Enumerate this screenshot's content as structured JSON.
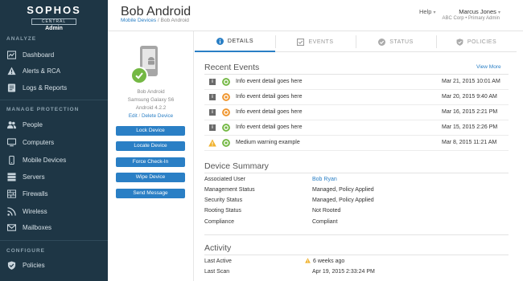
{
  "sidebar": {
    "logo": {
      "word": "SOPHOS",
      "central": "CENTRAL",
      "admin": "Admin"
    },
    "sections": {
      "analyze": "ANALYZE",
      "manage": "MANAGE PROTECTION",
      "configure": "CONFIGURE"
    },
    "items": [
      {
        "label": "Dashboard",
        "icon": "dashboard-icon"
      },
      {
        "label": "Alerts & RCA",
        "icon": "alert-icon"
      },
      {
        "label": "Logs & Reports",
        "icon": "logs-icon"
      },
      {
        "label": "People",
        "icon": "people-icon"
      },
      {
        "label": "Computers",
        "icon": "computer-icon"
      },
      {
        "label": "Mobile Devices",
        "icon": "mobile-icon"
      },
      {
        "label": "Servers",
        "icon": "server-icon"
      },
      {
        "label": "Firewalls",
        "icon": "firewall-icon"
      },
      {
        "label": "Wireless",
        "icon": "wireless-icon"
      },
      {
        "label": "Mailboxes",
        "icon": "mail-icon"
      },
      {
        "label": "Policies",
        "icon": "shield-icon"
      }
    ]
  },
  "header": {
    "title": "Bob Android",
    "breadcrumb": {
      "parent": "Mobile Devices",
      "separator": " / ",
      "current": "Bob Android"
    },
    "help": "Help",
    "user_name": "Marcus Jones",
    "user_org": "ABC Corp • Primary Admin"
  },
  "device": {
    "name": "Bob Android",
    "model": "Samsung Galaxy S6",
    "os": "Android 4.2.2",
    "edit_link": "Edit",
    "link_separator": "/",
    "delete_link": "Delete Device",
    "actions": [
      "Lock Device",
      "Locate Device",
      "Force Check-In",
      "Wipe Device",
      "Send Message"
    ]
  },
  "tabs": [
    {
      "label": "DETAILS",
      "icon": "info-icon",
      "active": true
    },
    {
      "label": "EVENTS",
      "icon": "events-icon",
      "active": false
    },
    {
      "label": "STATUS",
      "icon": "status-check-icon",
      "active": false
    },
    {
      "label": "POLICIES",
      "icon": "shield-icon",
      "active": false
    }
  ],
  "recent_events": {
    "heading": "Recent Events",
    "view_more": "View More",
    "rows": [
      {
        "type": "info",
        "status": "green",
        "text": "Info event detail goes here",
        "date": "Mar 21, 2015 10:01 AM"
      },
      {
        "type": "info",
        "status": "orange",
        "text": "Info event detail goes here",
        "date": "Mar 20, 2015  9:40 AM"
      },
      {
        "type": "info",
        "status": "orange",
        "text": "Info event detail goes here",
        "date": "Mar 16, 2015  2:21 PM"
      },
      {
        "type": "info",
        "status": "green",
        "text": "Info event detail goes here",
        "date": "Mar 15, 2015  2:26 PM"
      },
      {
        "type": "warning",
        "status": "green",
        "text": "Medium warning example",
        "date": "Mar 8, 2015 11:21 AM"
      }
    ]
  },
  "device_summary": {
    "heading": "Device Summary",
    "rows": [
      {
        "label": "Associated User",
        "value": "Bob Ryan",
        "link": true
      },
      {
        "label": "Management Status",
        "value": "Managed, Policy Applied",
        "link": false
      },
      {
        "label": "Security Status",
        "value": "Managed, Policy Applied",
        "link": false
      },
      {
        "label": "Rooting Status",
        "value": "Not Rooted",
        "link": false
      },
      {
        "label": "Compliance",
        "value": "Compliant",
        "link": false
      }
    ]
  },
  "activity": {
    "heading": "Activity",
    "rows": [
      {
        "label": "Last Active",
        "value": "6 weeks ago",
        "warn": true
      },
      {
        "label": "Last Scan",
        "value": "Apr 19, 2015 2:33:24 PM",
        "warn": false
      }
    ]
  },
  "colors": {
    "sidebar_bg": "#1e3645",
    "accent": "#2a7fc5",
    "ok_green": "#74b844",
    "warn_orange": "#f0962e",
    "info_grey": "#6a6a6a"
  }
}
